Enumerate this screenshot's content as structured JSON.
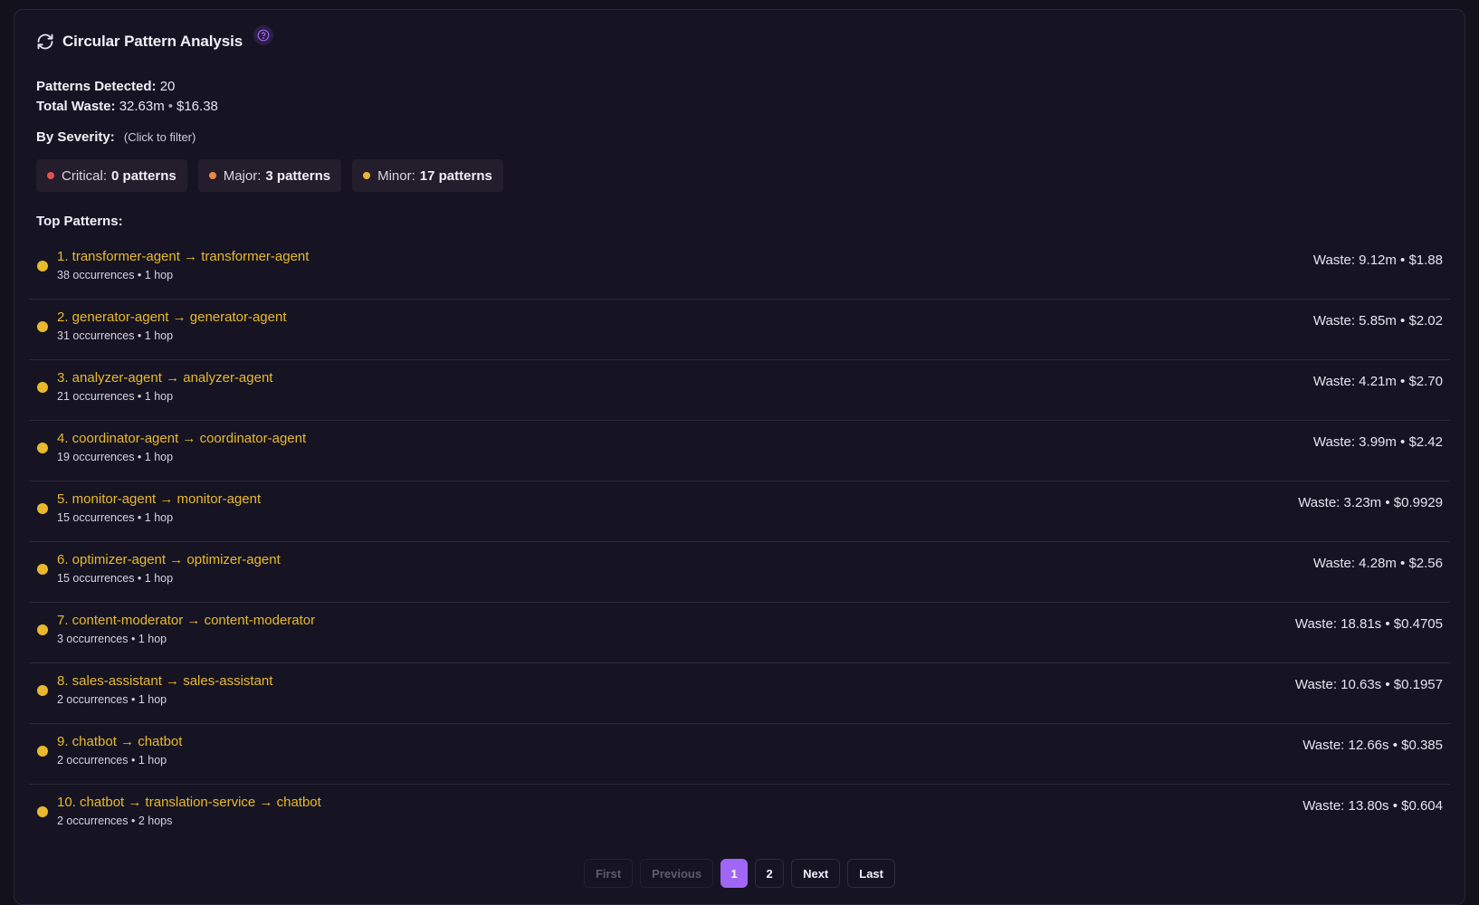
{
  "header": {
    "title": "Circular Pattern Analysis",
    "help_icon": "help-circle-icon",
    "refresh_icon": "refresh-icon"
  },
  "stats": {
    "patterns_label": "Patterns Detected:",
    "patterns_value": "20",
    "waste_label": "Total Waste:",
    "waste_time": "32.63m",
    "waste_cost": "$16.38",
    "separator": "•"
  },
  "severity": {
    "label": "By Severity:",
    "hint": "(Click to filter)",
    "chips": [
      {
        "name": "Critical:",
        "count": "0 patterns",
        "color": "#e05252"
      },
      {
        "name": "Major:",
        "count": "3 patterns",
        "color": "#ee8a3c"
      },
      {
        "name": "Minor:",
        "count": "17 patterns",
        "color": "#e8b92e"
      }
    ]
  },
  "top_patterns": {
    "label": "Top Patterns:",
    "items": [
      {
        "title": "1. transformer-agent → transformer-agent",
        "sub": "38 occurrences • 1 hop",
        "waste": "Waste: 9.12m • $1.88"
      },
      {
        "title": "2. generator-agent → generator-agent",
        "sub": "31 occurrences • 1 hop",
        "waste": "Waste: 5.85m • $2.02"
      },
      {
        "title": "3. analyzer-agent → analyzer-agent",
        "sub": "21 occurrences • 1 hop",
        "waste": "Waste: 4.21m • $2.70"
      },
      {
        "title": "4. coordinator-agent → coordinator-agent",
        "sub": "19 occurrences • 1 hop",
        "waste": "Waste: 3.99m • $2.42"
      },
      {
        "title": "5. monitor-agent → monitor-agent",
        "sub": "15 occurrences • 1 hop",
        "waste": "Waste: 3.23m • $0.9929"
      },
      {
        "title": "6. optimizer-agent → optimizer-agent",
        "sub": "15 occurrences • 1 hop",
        "waste": "Waste: 4.28m • $2.56"
      },
      {
        "title": "7. content-moderator → content-moderator",
        "sub": "3 occurrences • 1 hop",
        "waste": "Waste: 18.81s • $0.4705"
      },
      {
        "title": "8. sales-assistant → sales-assistant",
        "sub": "2 occurrences • 1 hop",
        "waste": "Waste: 10.63s • $0.1957"
      },
      {
        "title": "9. chatbot → chatbot",
        "sub": "2 occurrences • 1 hop",
        "waste": "Waste: 12.66s • $0.385"
      },
      {
        "title": "10. chatbot → translation-service → chatbot",
        "sub": "2 occurrences • 2 hops",
        "waste": "Waste: 13.80s • $0.604"
      }
    ]
  },
  "pagination": {
    "first": "First",
    "previous": "Previous",
    "pages": [
      "1",
      "2"
    ],
    "current": "1",
    "next": "Next",
    "last": "Last"
  },
  "colors": {
    "accent": "#a066f5",
    "pattern": "#e8b92e",
    "background": "#13111c"
  }
}
